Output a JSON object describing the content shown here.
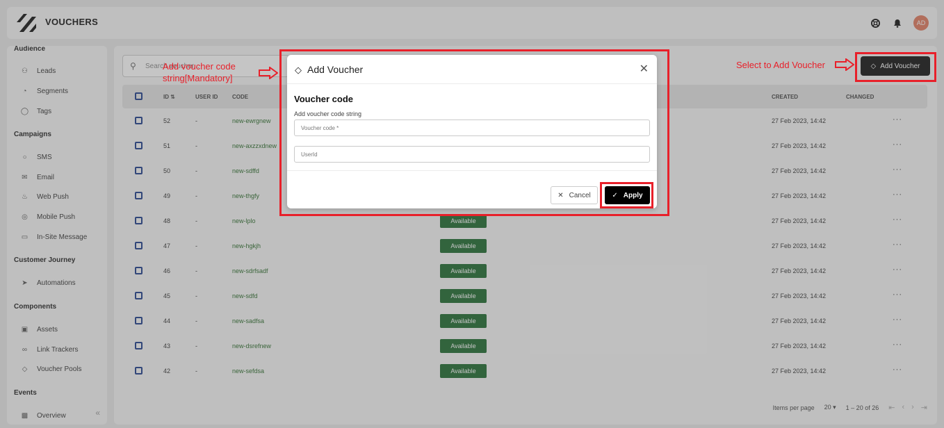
{
  "app": {
    "title": "VOUCHERS",
    "avatar_initials": "AD"
  },
  "sidebar": {
    "sections": [
      {
        "title": "Audience",
        "items": [
          {
            "label": "Leads",
            "icon": "users-icon"
          },
          {
            "label": "Segments",
            "icon": "pie-chart-icon"
          },
          {
            "label": "Tags",
            "icon": "tag-icon"
          }
        ]
      },
      {
        "title": "Campaigns",
        "items": [
          {
            "label": "SMS",
            "icon": "chat-icon"
          },
          {
            "label": "Email",
            "icon": "mail-icon"
          },
          {
            "label": "Web Push",
            "icon": "bell-icon"
          },
          {
            "label": "Mobile Push",
            "icon": "mobile-icon"
          },
          {
            "label": "In-Site Message",
            "icon": "window-icon"
          }
        ]
      },
      {
        "title": "Customer Journey",
        "items": [
          {
            "label": "Automations",
            "icon": "rocket-icon"
          }
        ]
      },
      {
        "title": "Components",
        "items": [
          {
            "label": "Assets",
            "icon": "database-icon"
          },
          {
            "label": "Link Trackers",
            "icon": "link-icon"
          },
          {
            "label": "Voucher Pools",
            "icon": "voucher-icon"
          }
        ]
      },
      {
        "title": "Events",
        "items": [
          {
            "label": "Overview",
            "icon": "overview-icon"
          }
        ]
      }
    ]
  },
  "toolbar": {
    "search_placeholder": "Search voucher...",
    "add_voucher_label": "Add Voucher"
  },
  "table": {
    "columns": [
      "ID",
      "USER ID",
      "CODE",
      "CREATED",
      "CHANGED"
    ],
    "rows": [
      {
        "id": "52",
        "user_id": "-",
        "code": "new-ewrgnew",
        "status": "",
        "created": "27 Feb 2023, 14:42"
      },
      {
        "id": "51",
        "user_id": "-",
        "code": "new-axzzxdnew",
        "status": "",
        "created": "27 Feb 2023, 14:42"
      },
      {
        "id": "50",
        "user_id": "-",
        "code": "new-sdffd",
        "status": "",
        "created": "27 Feb 2023, 14:42"
      },
      {
        "id": "49",
        "user_id": "-",
        "code": "new-thgfy",
        "status": "",
        "created": "27 Feb 2023, 14:42"
      },
      {
        "id": "48",
        "user_id": "-",
        "code": "new-lplo",
        "status": "Available",
        "created": "27 Feb 2023, 14:42"
      },
      {
        "id": "47",
        "user_id": "-",
        "code": "new-hgkjh",
        "status": "Available",
        "created": "27 Feb 2023, 14:42"
      },
      {
        "id": "46",
        "user_id": "-",
        "code": "new-sdrfsadf",
        "status": "Available",
        "created": "27 Feb 2023, 14:42"
      },
      {
        "id": "45",
        "user_id": "-",
        "code": "new-sdfd",
        "status": "Available",
        "created": "27 Feb 2023, 14:42"
      },
      {
        "id": "44",
        "user_id": "-",
        "code": "new-sadfsa",
        "status": "Available",
        "created": "27 Feb 2023, 14:42"
      },
      {
        "id": "43",
        "user_id": "-",
        "code": "new-dsrefnew",
        "status": "Available",
        "created": "27 Feb 2023, 14:42"
      },
      {
        "id": "42",
        "user_id": "-",
        "code": "new-sefdsa",
        "status": "Available",
        "created": "27 Feb 2023, 14:42"
      }
    ],
    "more_label": "···"
  },
  "pagination": {
    "items_per_page_label": "Items per page",
    "page_size": "20",
    "range": "1 – 20 of 26"
  },
  "dialog": {
    "title": "Add Voucher",
    "section_title": "Voucher code",
    "field_label": "Add voucher code string",
    "code_placeholder": "Voucher code *",
    "userid_placeholder": "UserId",
    "cancel_label": "Cancel",
    "apply_label": "Apply"
  },
  "annotations": {
    "left_note": "Add voucher code string[Mandatory]",
    "right_note": "Select to Add Voucher"
  },
  "colors": {
    "annotation_red": "#e8202a",
    "status_green": "#1e6a2f",
    "code_green": "#2a6b2a",
    "checkbox_blue": "#1d3d8a"
  }
}
